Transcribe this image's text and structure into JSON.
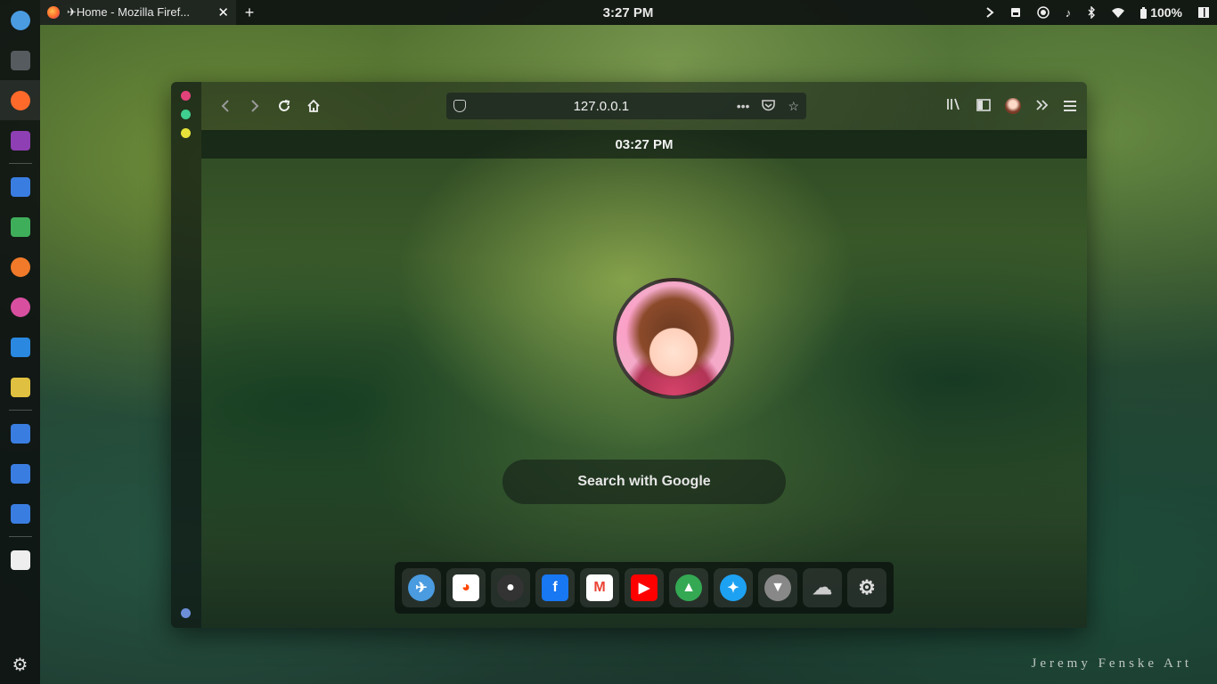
{
  "dock": {
    "items": [
      {
        "name": "app-launcher",
        "icon": "bird-icon",
        "color": "#4a9be0"
      },
      {
        "name": "terminal",
        "icon": "terminal-icon",
        "color": "#555b5e"
      },
      {
        "name": "firefox",
        "icon": "firefox-icon",
        "color": "#ff6a2b"
      },
      {
        "name": "text-editor",
        "icon": "editor-icon",
        "color": "#8e3fb3"
      },
      {
        "name": "files",
        "icon": "folder-icon",
        "color": "#3a7de0"
      },
      {
        "name": "media-player",
        "icon": "play-icon",
        "color": "#3fae5a"
      },
      {
        "name": "games",
        "icon": "gamepad-icon",
        "color": "#f07a2a"
      },
      {
        "name": "color-picker",
        "icon": "color-wheel-icon",
        "color": "#d84fa0"
      },
      {
        "name": "3d-app",
        "icon": "cube-icon",
        "color": "#2a88e0"
      },
      {
        "name": "settings-tool",
        "icon": "gears-icon",
        "color": "#e0c040"
      },
      {
        "name": "home-folder",
        "icon": "home-folder-icon",
        "color": "#3a7de0"
      },
      {
        "name": "documents-folder",
        "icon": "documents-folder-icon",
        "color": "#3a7de0"
      },
      {
        "name": "downloads-folder",
        "icon": "downloads-folder-icon",
        "color": "#3a7de0"
      },
      {
        "name": "trash",
        "icon": "trash-icon",
        "color": "#eeeeee"
      }
    ],
    "bottom_icon": "gear-icon"
  },
  "topbar": {
    "tab_title": "✈Home - Mozilla Firef...",
    "close_glyph": "✕",
    "new_tab_glyph": "+",
    "clock": "3:27 PM",
    "battery": "100%"
  },
  "browser": {
    "url": "127.0.0.1",
    "window_dot_colors": [
      "#e2427a",
      "#3fcf8e",
      "#e6e23a"
    ],
    "bottom_dot_color": "#6c8fd8"
  },
  "startpage": {
    "time": "03:27 PM",
    "search_label": "Search with Google",
    "quick_links": [
      {
        "name": "bird",
        "icon": "bird-icon",
        "color": "#4a9be0",
        "glyph": "✈"
      },
      {
        "name": "reddit",
        "icon": "reddit-icon",
        "color": "#ff4500",
        "glyph": "◕"
      },
      {
        "name": "github",
        "icon": "github-icon",
        "color": "#333333",
        "glyph": "●"
      },
      {
        "name": "facebook",
        "icon": "facebook-icon",
        "color": "#1877f2",
        "glyph": "f"
      },
      {
        "name": "gmail",
        "icon": "gmail-icon",
        "color": "#ea4335",
        "glyph": "M"
      },
      {
        "name": "youtube",
        "icon": "youtube-icon",
        "color": "#ff0000",
        "glyph": "▶"
      },
      {
        "name": "google-drive",
        "icon": "drive-icon",
        "color": "#34a853",
        "glyph": "▲"
      },
      {
        "name": "twitter",
        "icon": "twitter-icon",
        "color": "#1da1f2",
        "glyph": "✦"
      },
      {
        "name": "vivaldi",
        "icon": "vivaldi-icon",
        "color": "#888888",
        "glyph": "▼"
      },
      {
        "name": "cloud",
        "icon": "cloud-icon",
        "color": "#cccccc",
        "glyph": "☁"
      },
      {
        "name": "settings",
        "icon": "gear-icon",
        "color": "#dddddd",
        "glyph": "⚙"
      }
    ]
  },
  "wallpaper": {
    "credit": "Jeremy Fenske Art"
  }
}
